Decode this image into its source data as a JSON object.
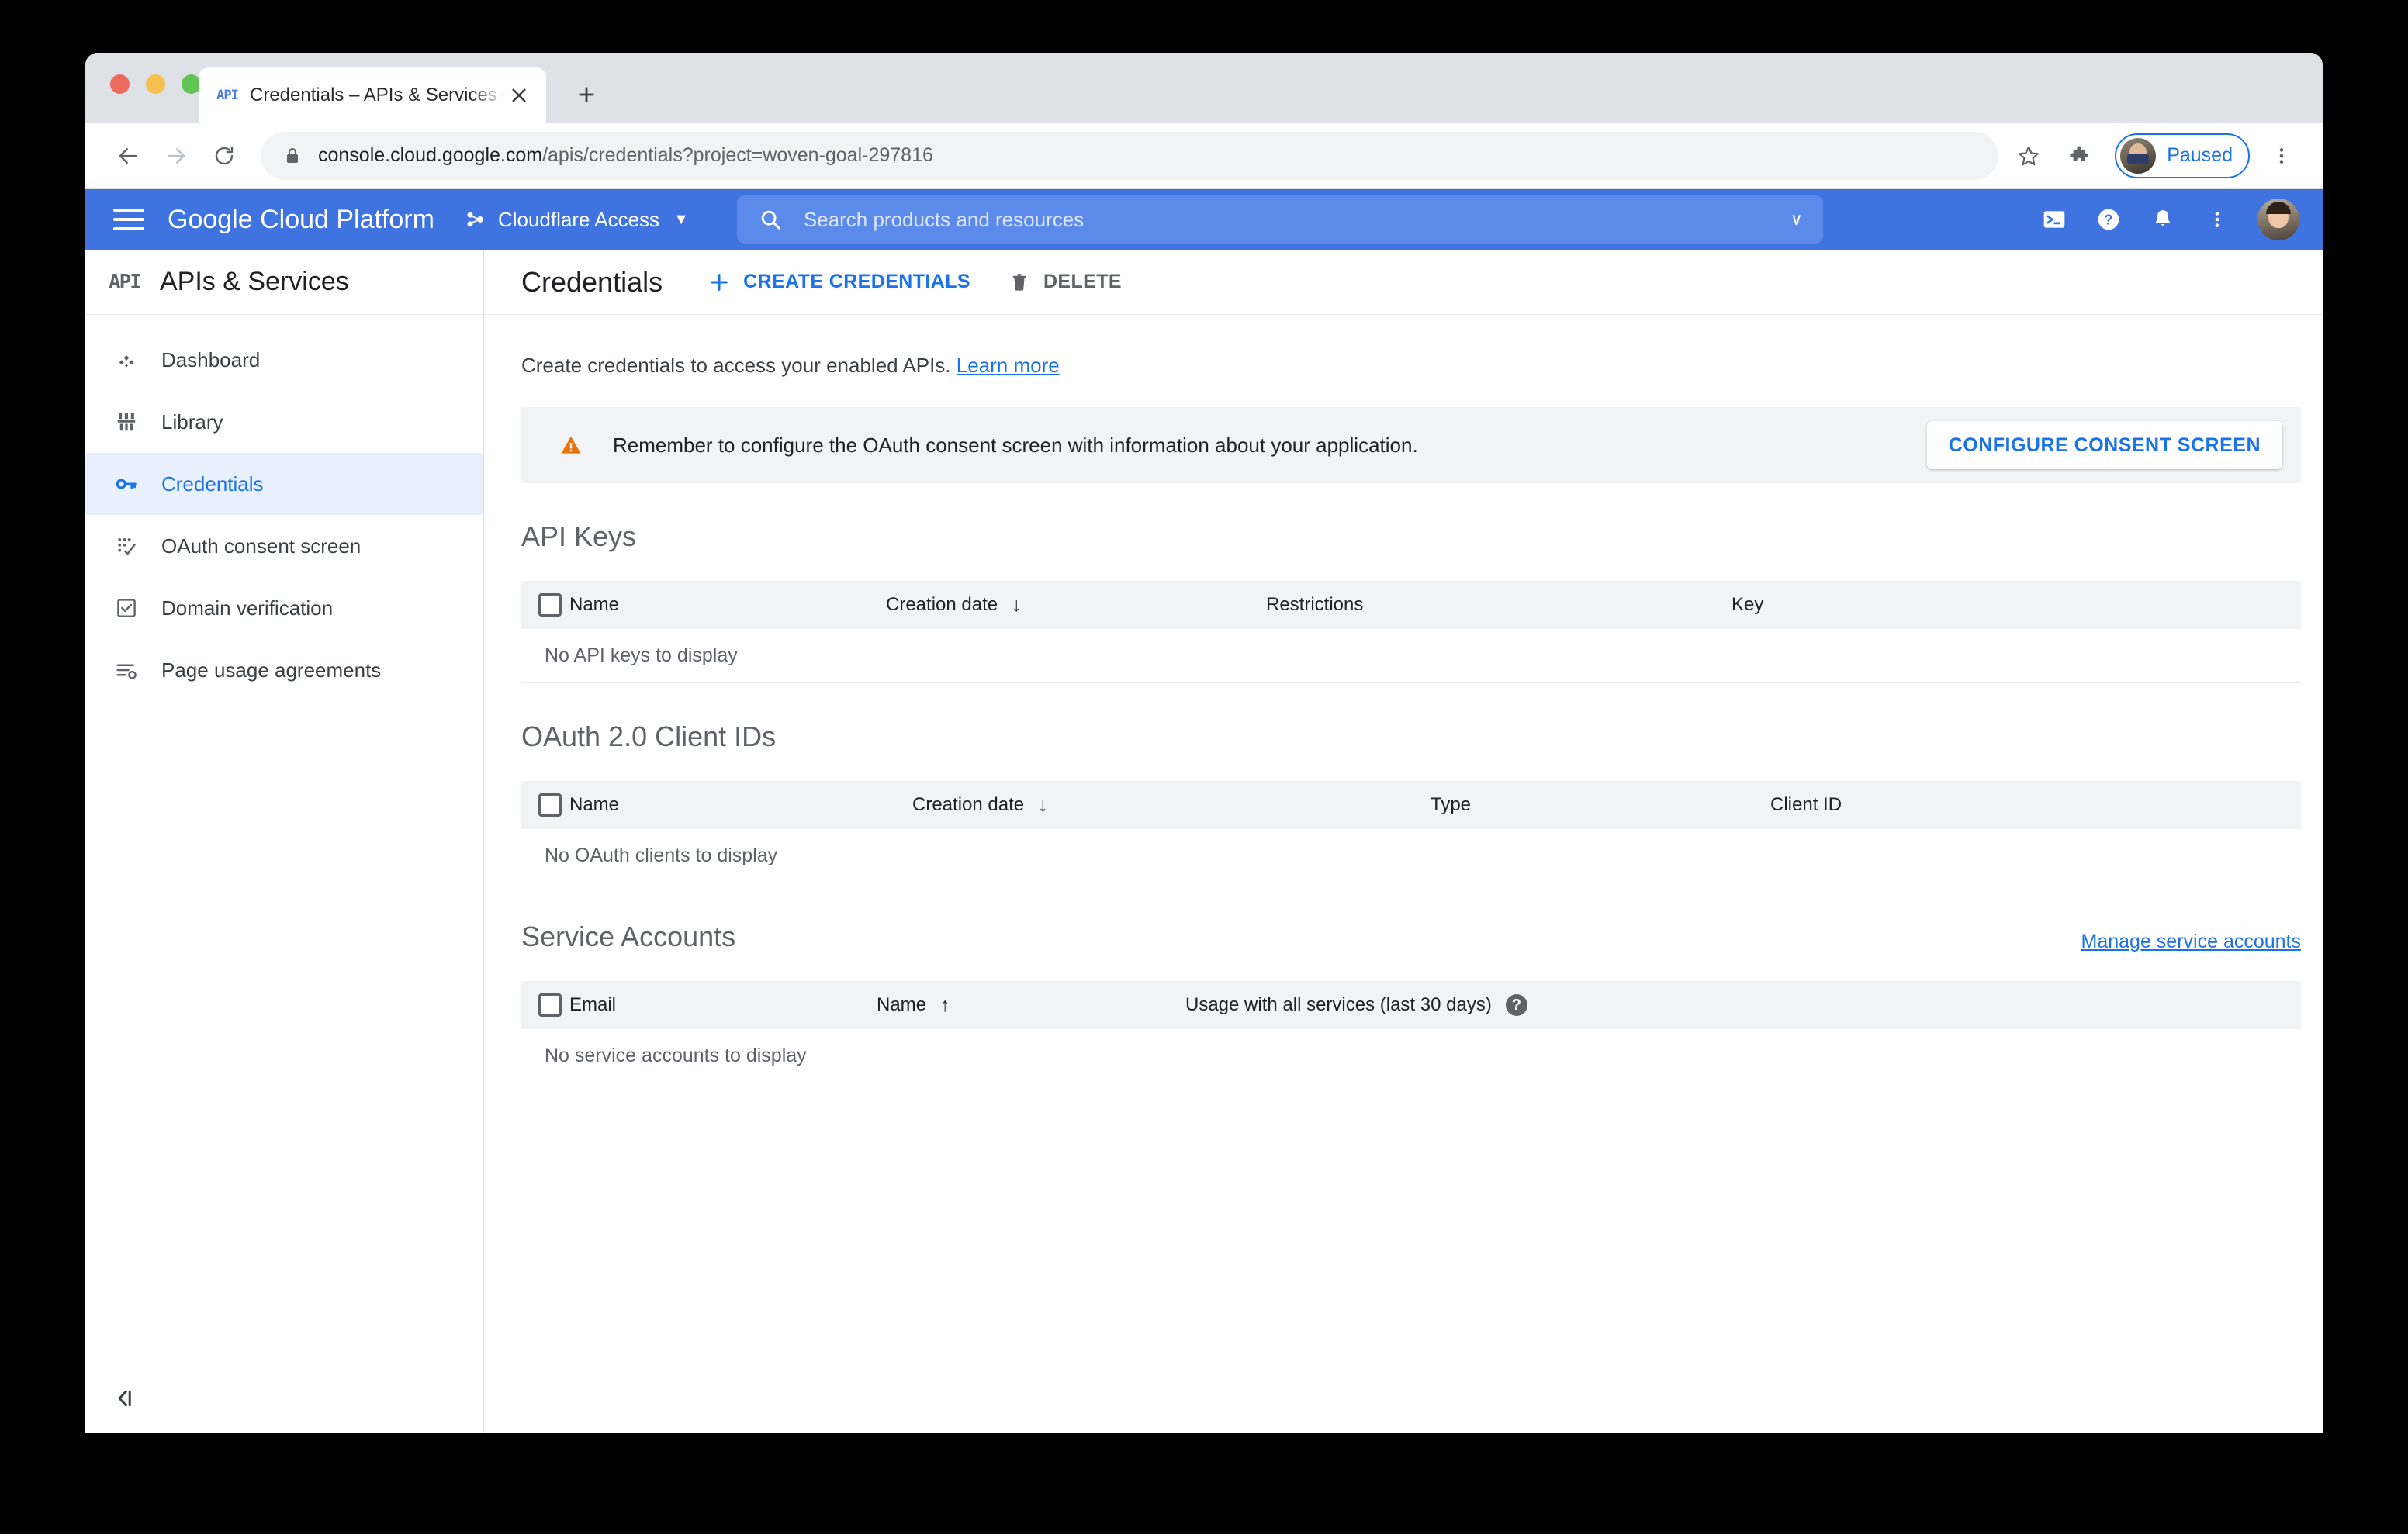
{
  "browser": {
    "tab": {
      "favicon": "api-favicon",
      "title": "Credentials – APIs & Services –"
    },
    "new_tab_label": "+",
    "close_label": "×",
    "url": {
      "host": "console.cloud.google.com",
      "path": "/apis/credentials?project=woven-goal-297816"
    },
    "profile_label": "Paused",
    "icons": {
      "back": "back-arrow-icon",
      "forward": "forward-arrow-icon",
      "reload": "reload-icon",
      "lock": "lock-icon",
      "bookmark": "star-icon",
      "extensions": "puzzle-piece-icon",
      "menu": "three-dot-menu-icon"
    }
  },
  "gcp_header": {
    "brand": "Google Cloud Platform",
    "project": "Cloudflare Access",
    "project_caret": "▼",
    "search_placeholder": "Search products and resources",
    "search_caret": "∨",
    "icons": {
      "hamburger": "hamburger-menu-icon",
      "project": "project-selector-icon",
      "search": "search-icon",
      "cloud_shell": "cloud-shell-terminal-icon",
      "help": "help-circle-icon",
      "notifications": "bell-icon",
      "more": "three-dot-menu-icon",
      "account": "account-avatar"
    }
  },
  "sidebar": {
    "logo_text": "API",
    "title": "APIs & Services",
    "collapse_label": "‹|",
    "items": [
      {
        "label": "Dashboard",
        "icon": "dashboard-icon",
        "active": false
      },
      {
        "label": "Library",
        "icon": "library-icon",
        "active": false
      },
      {
        "label": "Credentials",
        "icon": "key-icon",
        "active": true
      },
      {
        "label": "OAuth consent screen",
        "icon": "oauth-consent-icon",
        "active": false
      },
      {
        "label": "Domain verification",
        "icon": "checkbox-verified-icon",
        "active": false
      },
      {
        "label": "Page usage agreements",
        "icon": "page-usage-agreements-icon",
        "active": false
      }
    ]
  },
  "page": {
    "title": "Credentials",
    "actions": {
      "create": {
        "label": "CREATE CREDENTIALS",
        "icon": "plus-icon"
      },
      "delete": {
        "label": "DELETE",
        "icon": "trash-icon"
      }
    },
    "intro": {
      "text": "Create credentials to access your enabled APIs.",
      "link": "Learn more"
    },
    "banner": {
      "icon": "warning-triangle-icon",
      "text": "Remember to configure the OAuth consent screen with information about your application.",
      "button": "CONFIGURE CONSENT SCREEN"
    },
    "sections": [
      {
        "title": "API Keys",
        "link": null,
        "columns": [
          "Name",
          "Creation date",
          "Restrictions",
          "Key"
        ],
        "sort_column": "Creation date",
        "sort_direction": "↓",
        "empty_text": "No API keys to display",
        "rows": []
      },
      {
        "title": "OAuth 2.0 Client IDs",
        "link": null,
        "columns": [
          "Name",
          "Creation date",
          "Type",
          "Client ID"
        ],
        "sort_column": "Creation date",
        "sort_direction": "↓",
        "empty_text": "No OAuth clients to display",
        "rows": []
      },
      {
        "title": "Service Accounts",
        "link": "Manage service accounts",
        "columns": [
          "Email",
          "Name",
          "Usage with all services (last 30 days)"
        ],
        "sort_column": "Name",
        "sort_direction": "↑",
        "help_badge": "?",
        "empty_text": "No service accounts to display",
        "rows": []
      }
    ]
  },
  "colors": {
    "gcp_blue": "#3f74e0",
    "accent_blue": "#1a73e8",
    "active_bg": "#e8f0fe",
    "warning_orange": "#e8710a",
    "table_header_bg": "#f1f3f4",
    "banner_bg": "#f1f3f4"
  }
}
